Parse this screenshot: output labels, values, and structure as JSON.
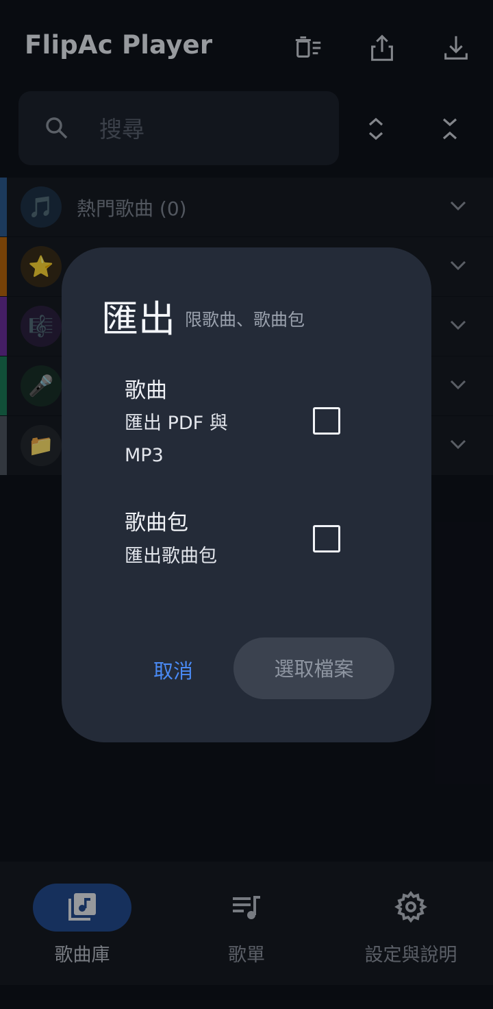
{
  "app": {
    "title": "FlipAc Player"
  },
  "header_icons": [
    "delete-list-icon",
    "share-icon",
    "download-icon"
  ],
  "search": {
    "placeholder": "搜尋"
  },
  "list_controls": [
    "expand-all-icon",
    "collapse-all-icon"
  ],
  "categories": [
    {
      "label": "熱門歌曲",
      "count": "(0)",
      "emoji": "🎵",
      "stripe_color": "#2b5a8e",
      "badge_bg": "#1e3247"
    },
    {
      "label": "",
      "count": "",
      "emoji": "⭐",
      "stripe_color": "#b5640b",
      "badge_bg": "#3a2d1a"
    },
    {
      "label": "",
      "count": "",
      "emoji": "🎼",
      "stripe_color": "#6a2f9c",
      "badge_bg": "#2c2140"
    },
    {
      "label": "",
      "count": "",
      "emoji": "🎤",
      "stripe_color": "#1b7a56",
      "badge_bg": "#1a3028"
    },
    {
      "label": "",
      "count": "",
      "emoji": "📁",
      "stripe_color": "#4e5560",
      "badge_bg": "#24282e"
    }
  ],
  "dialog": {
    "title": "匯出",
    "subtitle": "限歌曲、歌曲包",
    "options": [
      {
        "label": "歌曲",
        "desc": "匯出 PDF 與 MP3",
        "checked": false
      },
      {
        "label": "歌曲包",
        "desc": "匯出歌曲包",
        "checked": false
      }
    ],
    "cancel_label": "取消",
    "choose_label": "選取檔案"
  },
  "bottom_nav": [
    {
      "label": "歌曲庫",
      "icon": "library-music-icon",
      "active": true
    },
    {
      "label": "歌單",
      "icon": "playlist-icon",
      "active": false
    },
    {
      "label": "設定與說明",
      "icon": "gear-icon",
      "active": false
    }
  ],
  "colors": {
    "accent": "#4a8af4",
    "active_pill": "#234a8e",
    "dialog_bg": "#242b38"
  }
}
